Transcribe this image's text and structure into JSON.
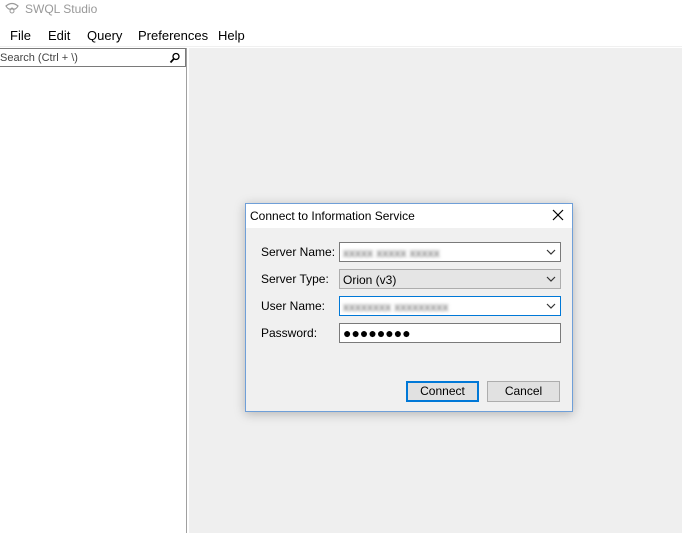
{
  "window": {
    "title": "SWQL Studio"
  },
  "menu": {
    "items": [
      "File",
      "Edit",
      "Query",
      "Preferences",
      "Help"
    ]
  },
  "sidebar": {
    "search_placeholder": "Search (Ctrl + \\)"
  },
  "dialog": {
    "title": "Connect to Information Service",
    "fields": {
      "server_name": {
        "label": "Server Name:",
        "value": "xxxxx xxxxx xxxxx"
      },
      "server_type": {
        "label": "Server Type:",
        "value": "Orion (v3)"
      },
      "user_name": {
        "label": "User Name:",
        "value": "xxxxxxxx xxxxxxxxx"
      },
      "password": {
        "label": "Password:",
        "value": "●●●●●●●●"
      }
    },
    "buttons": {
      "connect": "Connect",
      "cancel": "Cancel"
    }
  },
  "colors": {
    "accent": "#0078d7",
    "workspace_bg": "#efefef",
    "dialog_bg": "#f0f0f0",
    "dialog_border": "#6f9fd8"
  }
}
